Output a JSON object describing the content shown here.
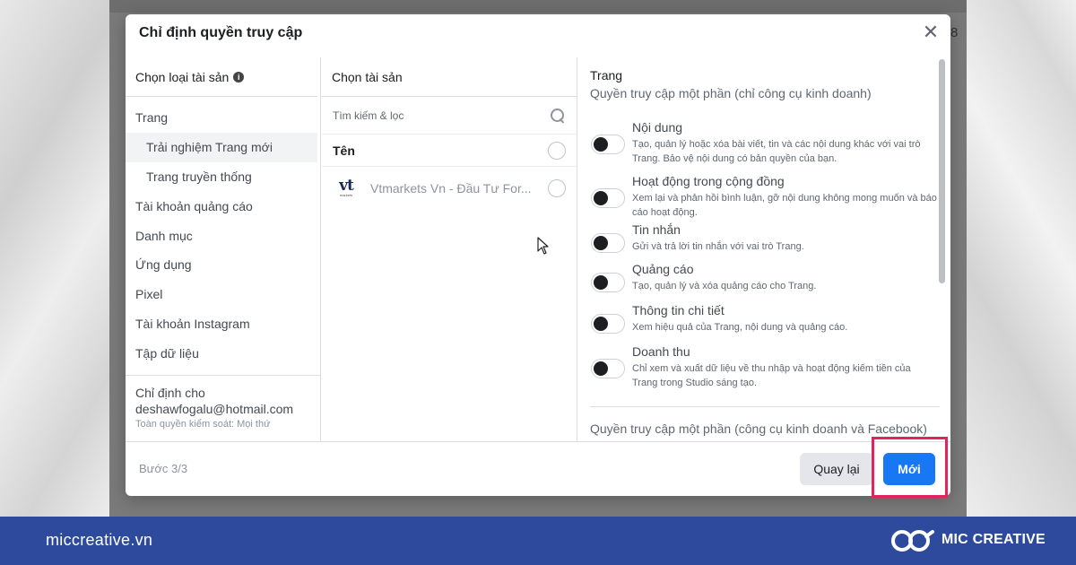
{
  "modal": {
    "title": "Chỉ định quyền truy cập",
    "close_icon": "close-icon"
  },
  "background": {
    "edge_text": "8"
  },
  "left_column": {
    "header": "Chọn loại tài sản",
    "info_icon": "info-icon",
    "items": [
      {
        "label": "Trang",
        "sub": false,
        "selected": false
      },
      {
        "label": "Trải nghiệm Trang mới",
        "sub": true,
        "selected": true
      },
      {
        "label": "Trang truyền thống",
        "sub": true,
        "selected": false
      },
      {
        "label": "Tài khoản quảng cáo",
        "sub": false,
        "selected": false
      },
      {
        "label": "Danh mục",
        "sub": false,
        "selected": false
      },
      {
        "label": "Ứng dụng",
        "sub": false,
        "selected": false
      },
      {
        "label": "Pixel",
        "sub": false,
        "selected": false
      },
      {
        "label": "Tài khoản Instagram",
        "sub": false,
        "selected": false
      },
      {
        "label": "Tập dữ liệu",
        "sub": false,
        "selected": false
      }
    ],
    "assign": {
      "title": "Chỉ định cho",
      "email": "deshawfogalu@hotmail.com",
      "role": "Toàn quyền kiểm soát: Mọi thứ"
    }
  },
  "middle_column": {
    "header": "Chọn tài sản",
    "search": {
      "placeholder": "Tìm kiếm & lọc",
      "value": ""
    },
    "name_header": "Tên",
    "pages": [
      {
        "logo_text": "vt",
        "logo_sub": "markets",
        "name": "Vtmarkets Vn - Đầu Tư For..."
      }
    ]
  },
  "right_column": {
    "title": "Trang",
    "subtitle": "Quyền truy cập một phần (chỉ công cụ kinh doanh)",
    "permissions": [
      {
        "title": "Nội dung",
        "description": "Tạo, quản lý hoặc xóa bài viết, tin và các nội dung khác với vai trò Trang. Bảo vệ nội dung có bản quyền của bạn.",
        "enabled": false
      },
      {
        "title": "Hoạt động trong cộng đồng",
        "description": "Xem lại và phản hồi bình luận, gỡ nội dung không mong muốn và báo cáo hoạt động.",
        "enabled": false
      },
      {
        "title": "Tin nhắn",
        "description": "Gửi và trả lời tin nhắn với vai trò Trang.",
        "enabled": false
      },
      {
        "title": "Quảng cáo",
        "description": "Tạo, quản lý và xóa quảng cáo cho Trang.",
        "enabled": false
      },
      {
        "title": "Thông tin chi tiết",
        "description": "Xem hiệu quả của Trang, nội dung và quảng cáo.",
        "enabled": false
      },
      {
        "title": "Doanh thu",
        "description": "Chỉ xem và xuất dữ liệu về thu nhập và hoạt động kiếm tiền của Trang trong Studio sáng tạo.",
        "enabled": false
      }
    ],
    "section2_title": "Quyền truy cập một phần (công cụ kinh doanh và Facebook)"
  },
  "footer": {
    "step": "Bước 3/3",
    "back_label": "Quay lại",
    "new_label": "Mới",
    "highlight_color": "#e0245e"
  },
  "brand": {
    "url": "miccreative.vn",
    "name": "MIC CREATIVE",
    "bar_color": "#2e4a9c"
  }
}
